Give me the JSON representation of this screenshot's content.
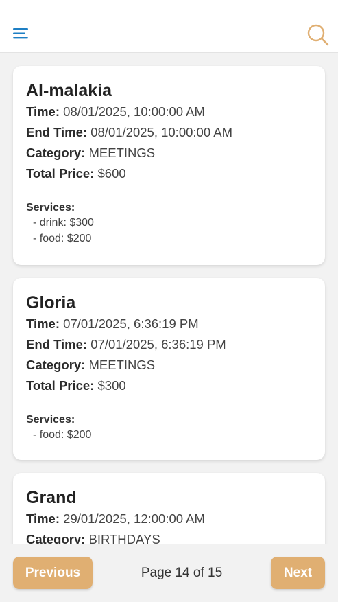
{
  "header": {
    "menu_icon": "hamburger-menu-icon",
    "search_icon": "search-icon",
    "accent_menu": "#1e7fc4",
    "accent_search": "#e0af72"
  },
  "labels": {
    "time": "Time:",
    "end_time": "End Time:",
    "category": "Category:",
    "total_price": "Total Price:",
    "services": "Services:"
  },
  "bookings": [
    {
      "name": "Al-malakia",
      "time": "08/01/2025, 10:00:00 AM",
      "end_time": "08/01/2025, 10:00:00 AM",
      "category": "MEETINGS",
      "total_price": "$600",
      "services": [
        "- drink: $300",
        "- food: $200"
      ]
    },
    {
      "name": "Gloria",
      "time": "07/01/2025, 6:36:19 PM",
      "end_time": "07/01/2025, 6:36:19 PM",
      "category": "MEETINGS",
      "total_price": "$300",
      "services": [
        "- food: $200"
      ]
    },
    {
      "name": "Grand",
      "time": "29/01/2025, 12:00:00 AM",
      "category": "BIRTHDAYS"
    }
  ],
  "pagination": {
    "previous_label": "Previous",
    "page_text": "Page 14 of 15",
    "next_label": "Next",
    "button_color": "#e0af72"
  }
}
